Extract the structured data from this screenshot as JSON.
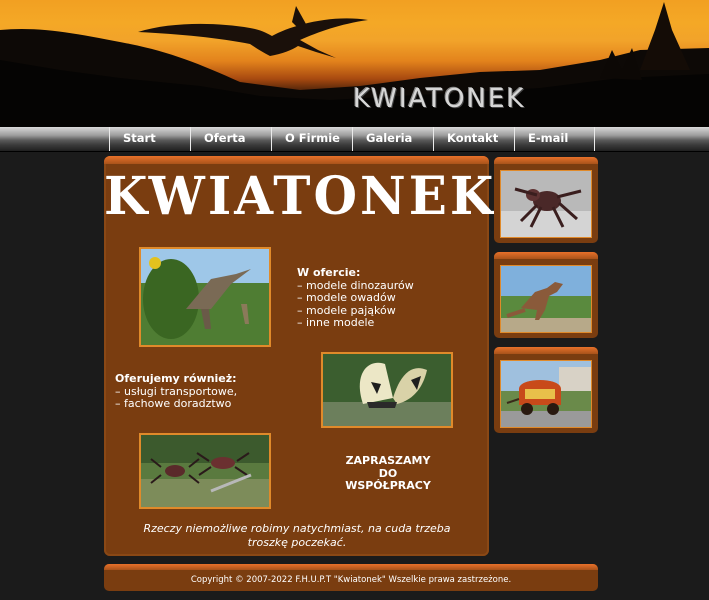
{
  "header": {
    "brand": "KWIATONEK"
  },
  "nav": {
    "items": [
      "Start",
      "Oferta",
      "O Firmie",
      "Galeria",
      "Kontakt",
      "E-mail"
    ]
  },
  "main": {
    "title": "KWIATONEK",
    "offer_heading": "W ofercie:",
    "offer_items": [
      "– modele dinozaurów",
      "– modele owadów",
      "– modele pająków",
      "– inne modele"
    ],
    "also_heading": "Oferujemy również:",
    "also_items": [
      "– usługi transportowe,",
      "– fachowe doradztwo"
    ],
    "invite": [
      "ZAPRASZAMY",
      "DO",
      "WSPÓŁPRACY"
    ],
    "motto": "Rzeczy niemożliwe robimy natychmiast, na cuda trzeba troszkę poczekać."
  },
  "footer": {
    "copyright": "Copyright © 2007-2022 F.H.U.P.T \"Kwiatonek\" Wszelkie prawa zastrzeżone."
  },
  "colors": {
    "panel": "#7a3d10",
    "accent": "#e8712a",
    "sky": "#f2a022"
  }
}
